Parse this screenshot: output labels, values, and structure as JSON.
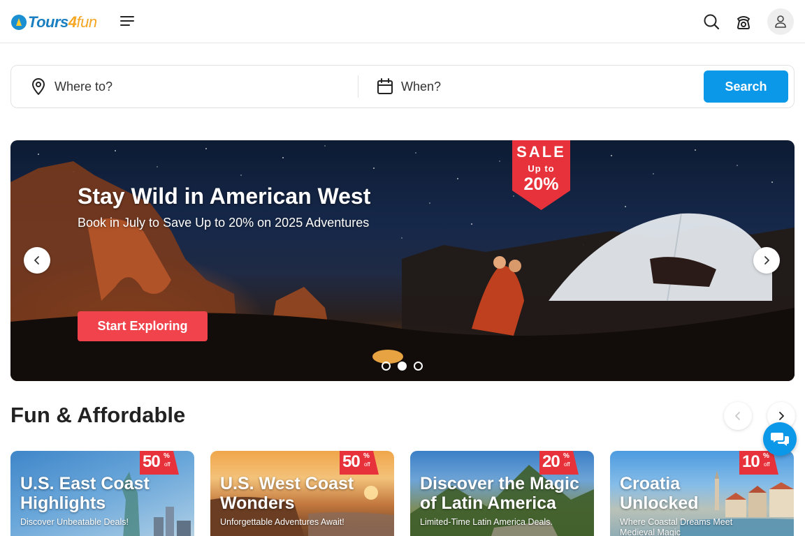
{
  "brand": {
    "logo_parts": [
      "Tours",
      "4",
      "fun"
    ]
  },
  "header": {
    "icons": [
      "menu-icon",
      "search-icon",
      "phone-support-icon",
      "user-icon"
    ]
  },
  "search": {
    "where_placeholder": "Where to?",
    "when_placeholder": "When?",
    "button_label": "Search",
    "accent_color": "#0b98e8"
  },
  "hero": {
    "title": "Stay Wild in American West",
    "subtitle": "Book in July to Save Up to 20% on 2025 Adventures",
    "cta_label": "Start Exploring",
    "cta_color": "#f0434b",
    "sale_badge": {
      "line1": "SALE",
      "line2": "Up to",
      "line3": "20%"
    },
    "slides_count": 3,
    "active_slide": 2
  },
  "section": {
    "title": "Fun & Affordable",
    "cards": [
      {
        "title_line1": "U.S. East Coast",
        "title_line2": "Highlights",
        "subtitle": "Discover Unbeatable Deals!",
        "badge_value": "50",
        "badge_pct": "%",
        "badge_off": "off"
      },
      {
        "title_line1": "U.S. West Coast",
        "title_line2": "Wonders",
        "subtitle": "Unforgettable Adventures Await!",
        "badge_value": "50",
        "badge_pct": "%",
        "badge_off": "off"
      },
      {
        "title_line1": "Discover the Magic",
        "title_line2": "of Latin America",
        "subtitle": "Limited-Time Latin America Deals.",
        "badge_value": "20",
        "badge_pct": "%",
        "badge_off": "off"
      },
      {
        "title_line1": "Croatia",
        "title_line2": "Unlocked",
        "subtitle": "Where Coastal Dreams Meet Medieval Magic",
        "badge_value": "10",
        "badge_pct": "%",
        "badge_off": "off"
      }
    ]
  },
  "chat": {
    "icon": "chat-icon"
  }
}
